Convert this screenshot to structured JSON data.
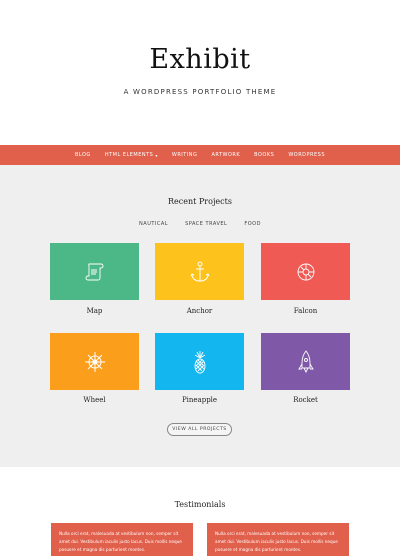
{
  "site": {
    "title": "Exhibit",
    "tagline": "A WORDPRESS PORTFOLIO THEME"
  },
  "nav": [
    {
      "label": "BLOG"
    },
    {
      "label": "HTML ELEMENTS",
      "caret": "▾"
    },
    {
      "label": "WRITING"
    },
    {
      "label": "ARTWORK"
    },
    {
      "label": "BOOKS"
    },
    {
      "label": "WORDPRESS"
    }
  ],
  "projects": {
    "title": "Recent Projects",
    "filters": [
      "NAUTICAL",
      "SPACE TRAVEL",
      "FOOD"
    ],
    "items": [
      {
        "label": "Map",
        "color": "#4cb887",
        "icon": "map-scroll-icon"
      },
      {
        "label": "Anchor",
        "color": "#fdc21b",
        "icon": "anchor-icon"
      },
      {
        "label": "Falcon",
        "color": "#ef5a54",
        "icon": "falcon-ship-icon"
      },
      {
        "label": "Wheel",
        "color": "#fb9e1c",
        "icon": "ship-wheel-icon"
      },
      {
        "label": "Pineapple",
        "color": "#13b6ef",
        "icon": "pineapple-icon"
      },
      {
        "label": "Rocket",
        "color": "#7f59a7",
        "icon": "rocket-icon"
      }
    ],
    "view_all": "VIEW ALL PROJECTS"
  },
  "testimonials": {
    "title": "Testimonials",
    "quotes": [
      {
        "text": "Nulla orci erat, malesuada at vestibulum non, semper sit amet dui. Vestibulum iaculis justo lacus. Duis mollis neque posuere et magna dis parturient montes."
      },
      {
        "text": "Nulla orci erat, malesuada at vestibulum non, semper sit amet dui. Vestibulum iaculis justo lacus. Duis mollis neque posuere et magna dis parturient montes."
      }
    ]
  },
  "colors": {
    "accent": "#e0604c",
    "section_bg": "#efefef"
  }
}
